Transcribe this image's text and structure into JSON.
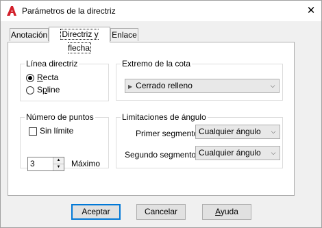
{
  "window": {
    "title": "Parámetros de la directriz",
    "close_glyph": "✕",
    "icon": "autocad-icon"
  },
  "tabs": [
    {
      "label": "Anotación",
      "active": false
    },
    {
      "label": "Directriz y flecha",
      "active": true
    },
    {
      "label": "Enlace",
      "active": false
    }
  ],
  "leader_line": {
    "label": "Línea directriz",
    "options": [
      {
        "label": "Recta",
        "selected": true
      },
      {
        "label": "Spline",
        "selected": false
      }
    ]
  },
  "arrowhead": {
    "label": "Extremo de la cota",
    "selected": "Cerrado relleno"
  },
  "points": {
    "label": "Número de puntos",
    "no_limit_label": "Sin límite",
    "no_limit_checked": false,
    "value": "3",
    "max_label": "Máximo"
  },
  "angle_constraints": {
    "label": "Limitaciones de ángulo",
    "first_segment_label": "Primer segmento:",
    "first_segment_value": "Cualquier ángulo",
    "second_segment_label": "Segundo segmento:",
    "second_segment_value": "Cualquier ángulo"
  },
  "buttons": {
    "ok": "Aceptar",
    "cancel": "Cancelar",
    "help": "Ayuda"
  },
  "colors": {
    "accent": "#0078d7",
    "icon_red": "#d21f2a"
  }
}
